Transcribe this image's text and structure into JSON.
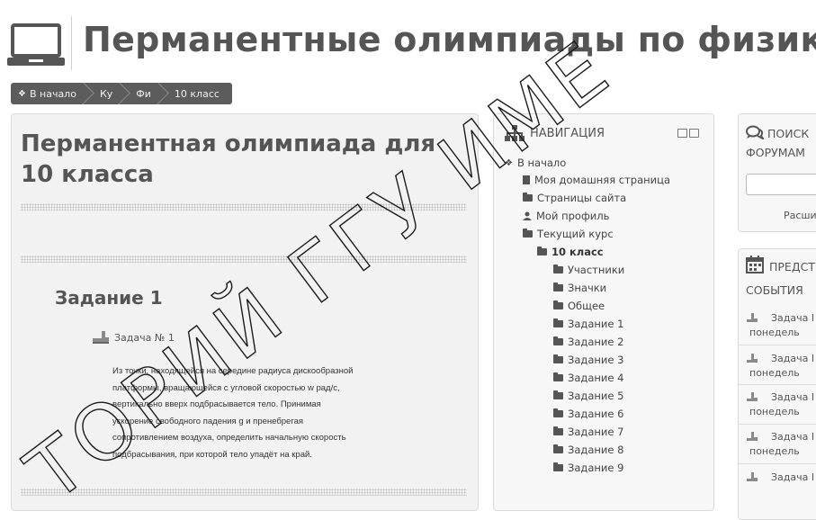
{
  "site": {
    "title": "Перманентные олимпиады по физике"
  },
  "breadcrumb": [
    {
      "label": "В начало"
    },
    {
      "label": "Ку"
    },
    {
      "label": "Фи"
    },
    {
      "label": "10 класс"
    }
  ],
  "main": {
    "course_title": "Перманентная олимпиада для 10 класса",
    "section_title": "Задание 1",
    "activity_label": "Задача № 1",
    "task_lines": [
      "Из точки, находящейся на середине радиуса дискообразной",
      "платформы, вращающейся с угловой скоростью w рад/с,",
      "вертикально вверх подбрасывается тело. Принимая",
      "ускорение свободного падения g и пренебрегая",
      "сопротивлением воздуха, определить начальную скорость",
      "подбрасывания, при которой тело упадёт на край."
    ]
  },
  "navigation": {
    "title": "НАВИГАЦИЯ",
    "items": [
      {
        "label": "В начало",
        "icon": "home-icon"
      },
      {
        "label": "Моя домашняя страница",
        "icon": "document-icon"
      },
      {
        "label": "Страницы сайта",
        "icon": "folder-icon"
      },
      {
        "label": "Мой профиль",
        "icon": "user-icon"
      },
      {
        "label": "Текущий курс",
        "icon": "folder-open-icon"
      },
      {
        "label": "10 класс",
        "icon": "folder-open-icon"
      },
      {
        "label": "Участники",
        "icon": "folder-icon"
      },
      {
        "label": "Значки",
        "icon": "folder-icon"
      },
      {
        "label": "Общее",
        "icon": "folder-icon"
      },
      {
        "label": "Задание 1",
        "icon": "folder-icon"
      },
      {
        "label": "Задание 2",
        "icon": "folder-icon"
      },
      {
        "label": "Задание 3",
        "icon": "folder-icon"
      },
      {
        "label": "Задание 4",
        "icon": "folder-icon"
      },
      {
        "label": "Задание 5",
        "icon": "folder-icon"
      },
      {
        "label": "Задание 6",
        "icon": "folder-icon"
      },
      {
        "label": "Задание 7",
        "icon": "folder-icon"
      },
      {
        "label": "Задание 8",
        "icon": "folder-icon"
      },
      {
        "label": "Задание 9",
        "icon": "folder-icon"
      }
    ]
  },
  "search_forums": {
    "title_line1": "ПОИСК",
    "title_line2": "ФОРУМАМ",
    "advanced_link": "Расши"
  },
  "events": {
    "title_line1": "ПРЕДСТ",
    "title_line2": "СОБЫТИЯ",
    "items": [
      {
        "line1": "Задача I",
        "line2": "понедель"
      },
      {
        "line1": "Задача I",
        "line2": "понедель"
      },
      {
        "line1": "Задача I",
        "line2": "понедель"
      },
      {
        "line1": "Задача I",
        "line2": "понедель"
      },
      {
        "line1": "Задача I",
        "line2": ""
      }
    ]
  },
  "watermark": {
    "text": "ТОРИЙ ГГУ ИМЕ"
  }
}
